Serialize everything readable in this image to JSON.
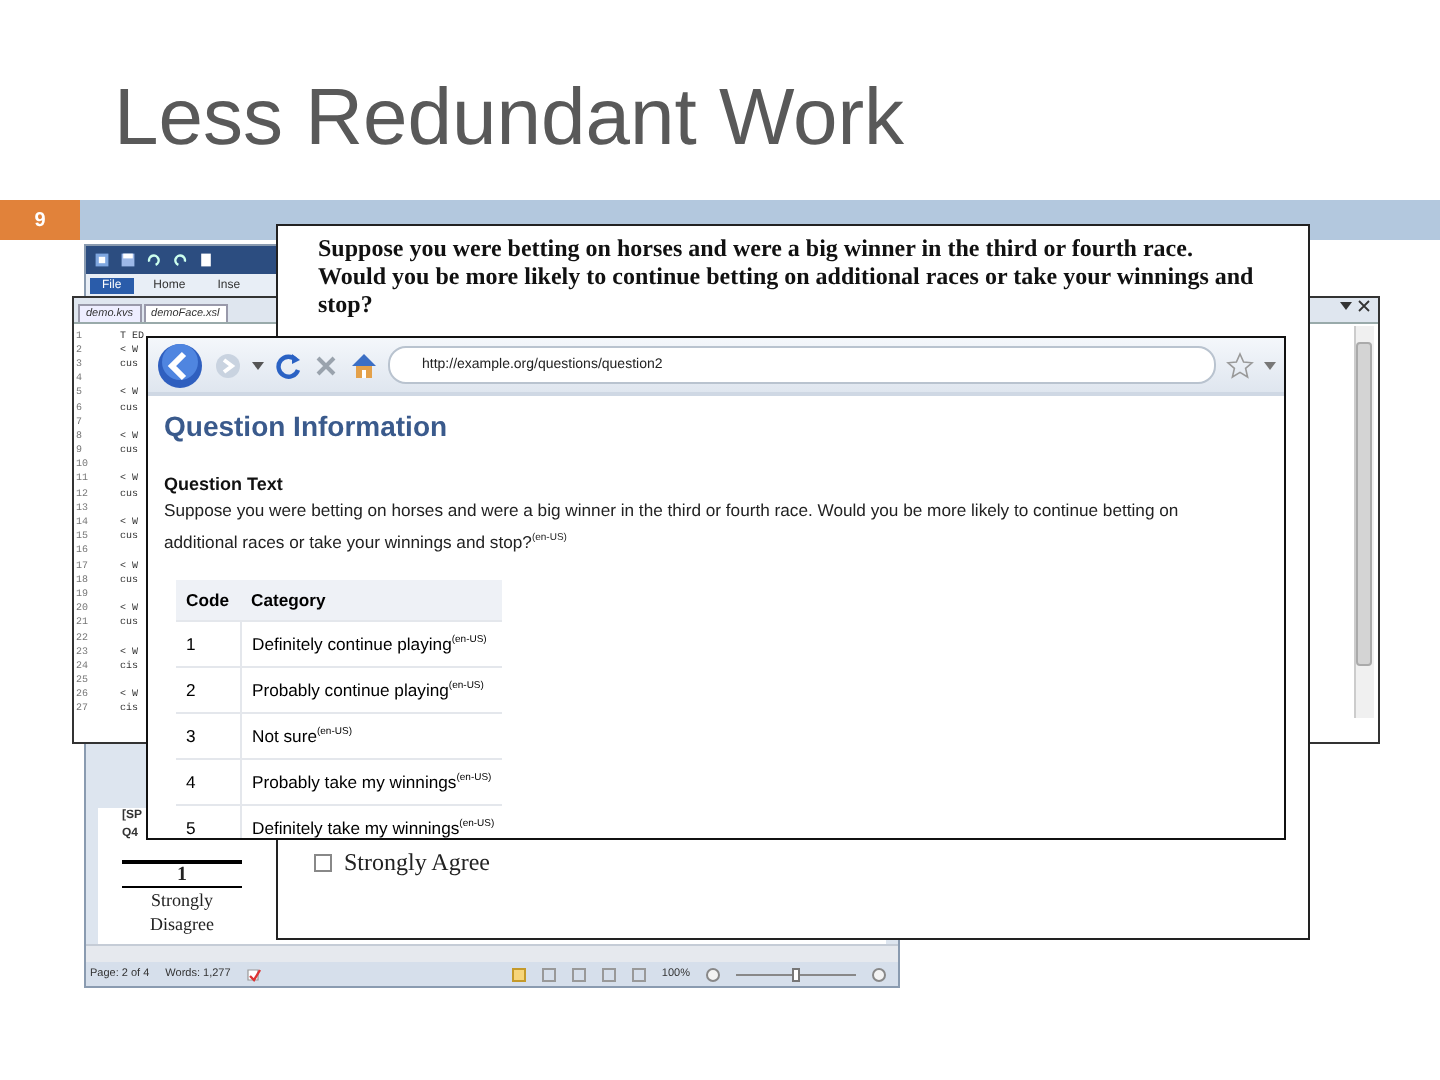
{
  "slide": {
    "title": "Less Redundant Work",
    "page_number": "9"
  },
  "word_window": {
    "ribbon_tabs": [
      {
        "label": "File",
        "selected": true
      },
      {
        "label": "Home",
        "selected": false
      },
      {
        "label": "Inse",
        "selected": false
      }
    ],
    "body_texts": [
      "[SP",
      "Q4"
    ],
    "scale": {
      "column": "1",
      "label": "Strongly Disagree"
    },
    "status": {
      "page": "Page: 2 of 4",
      "words": "Words: 1,277",
      "zoom": "100%",
      "zoom_slider": {
        "level": 0.5
      }
    }
  },
  "editor_window": {
    "tabs": [
      {
        "label": "demo.kvs",
        "selected": false
      },
      {
        "label": "demoFace.xsl",
        "selected": true
      }
    ],
    "lines": [
      {
        "number": "1",
        "code": "T ED"
      },
      {
        "number": "2",
        "code": "< W"
      },
      {
        "number": "3",
        "code": "cus"
      },
      {
        "number": "4"
      },
      {
        "number": "5",
        "code": "< W"
      },
      {
        "number": "6",
        "code": "cus"
      },
      {
        "number": "7"
      },
      {
        "number": "8",
        "code": "< W"
      },
      {
        "number": "9",
        "code": "cus"
      },
      {
        "number": "10"
      },
      {
        "number": "11",
        "code": "< W"
      },
      {
        "number": "12",
        "code": "cus"
      },
      {
        "number": "13"
      },
      {
        "number": "14",
        "code": "< W"
      },
      {
        "number": "15",
        "code": "cus"
      },
      {
        "number": "16"
      },
      {
        "number": "17",
        "code": "< W"
      },
      {
        "number": "18",
        "code": "cus"
      },
      {
        "number": "19"
      },
      {
        "number": "20",
        "code": "< W"
      },
      {
        "number": "21",
        "code": "cus"
      },
      {
        "number": "22"
      },
      {
        "number": "23",
        "code": "< W"
      },
      {
        "number": "24",
        "code": "cis"
      },
      {
        "number": "25"
      },
      {
        "number": "26",
        "code": "< W"
      },
      {
        "number": "27",
        "code": "cis"
      }
    ]
  },
  "question_doc": {
    "question": "Suppose you were betting on horses and were a big winner in the third or fourth race. Would you be more likely to continue betting on additional races or take your winnings and stop?",
    "option": {
      "label": "Strongly Agree",
      "checked": false
    }
  },
  "browser": {
    "url": "http://example.org/questions/question2",
    "heading": "Question Information",
    "section": "Question Text",
    "text": "Suppose you were betting on horses and were a big winner in the third or fourth race. Would you be more likely to continue betting on additional races or take your winnings and stop?$^{(en-US)}$",
    "table": {
      "columns": [
        "Code",
        "Category"
      ],
      "rows": [
        {
          "code": "1",
          "category": "Definitely continue playing$^{(en-US)}$"
        },
        {
          "code": "2",
          "category": "Probably continue playing$^{(en-US)}$"
        },
        {
          "code": "3",
          "category": "Not sure$^{(en-US)}$"
        },
        {
          "code": "4",
          "category": "Probably take my winnings$^{(en-US)}$"
        },
        {
          "code": "5",
          "category": "Definitely take my winnings$^{(en-US)}$"
        }
      ]
    }
  }
}
